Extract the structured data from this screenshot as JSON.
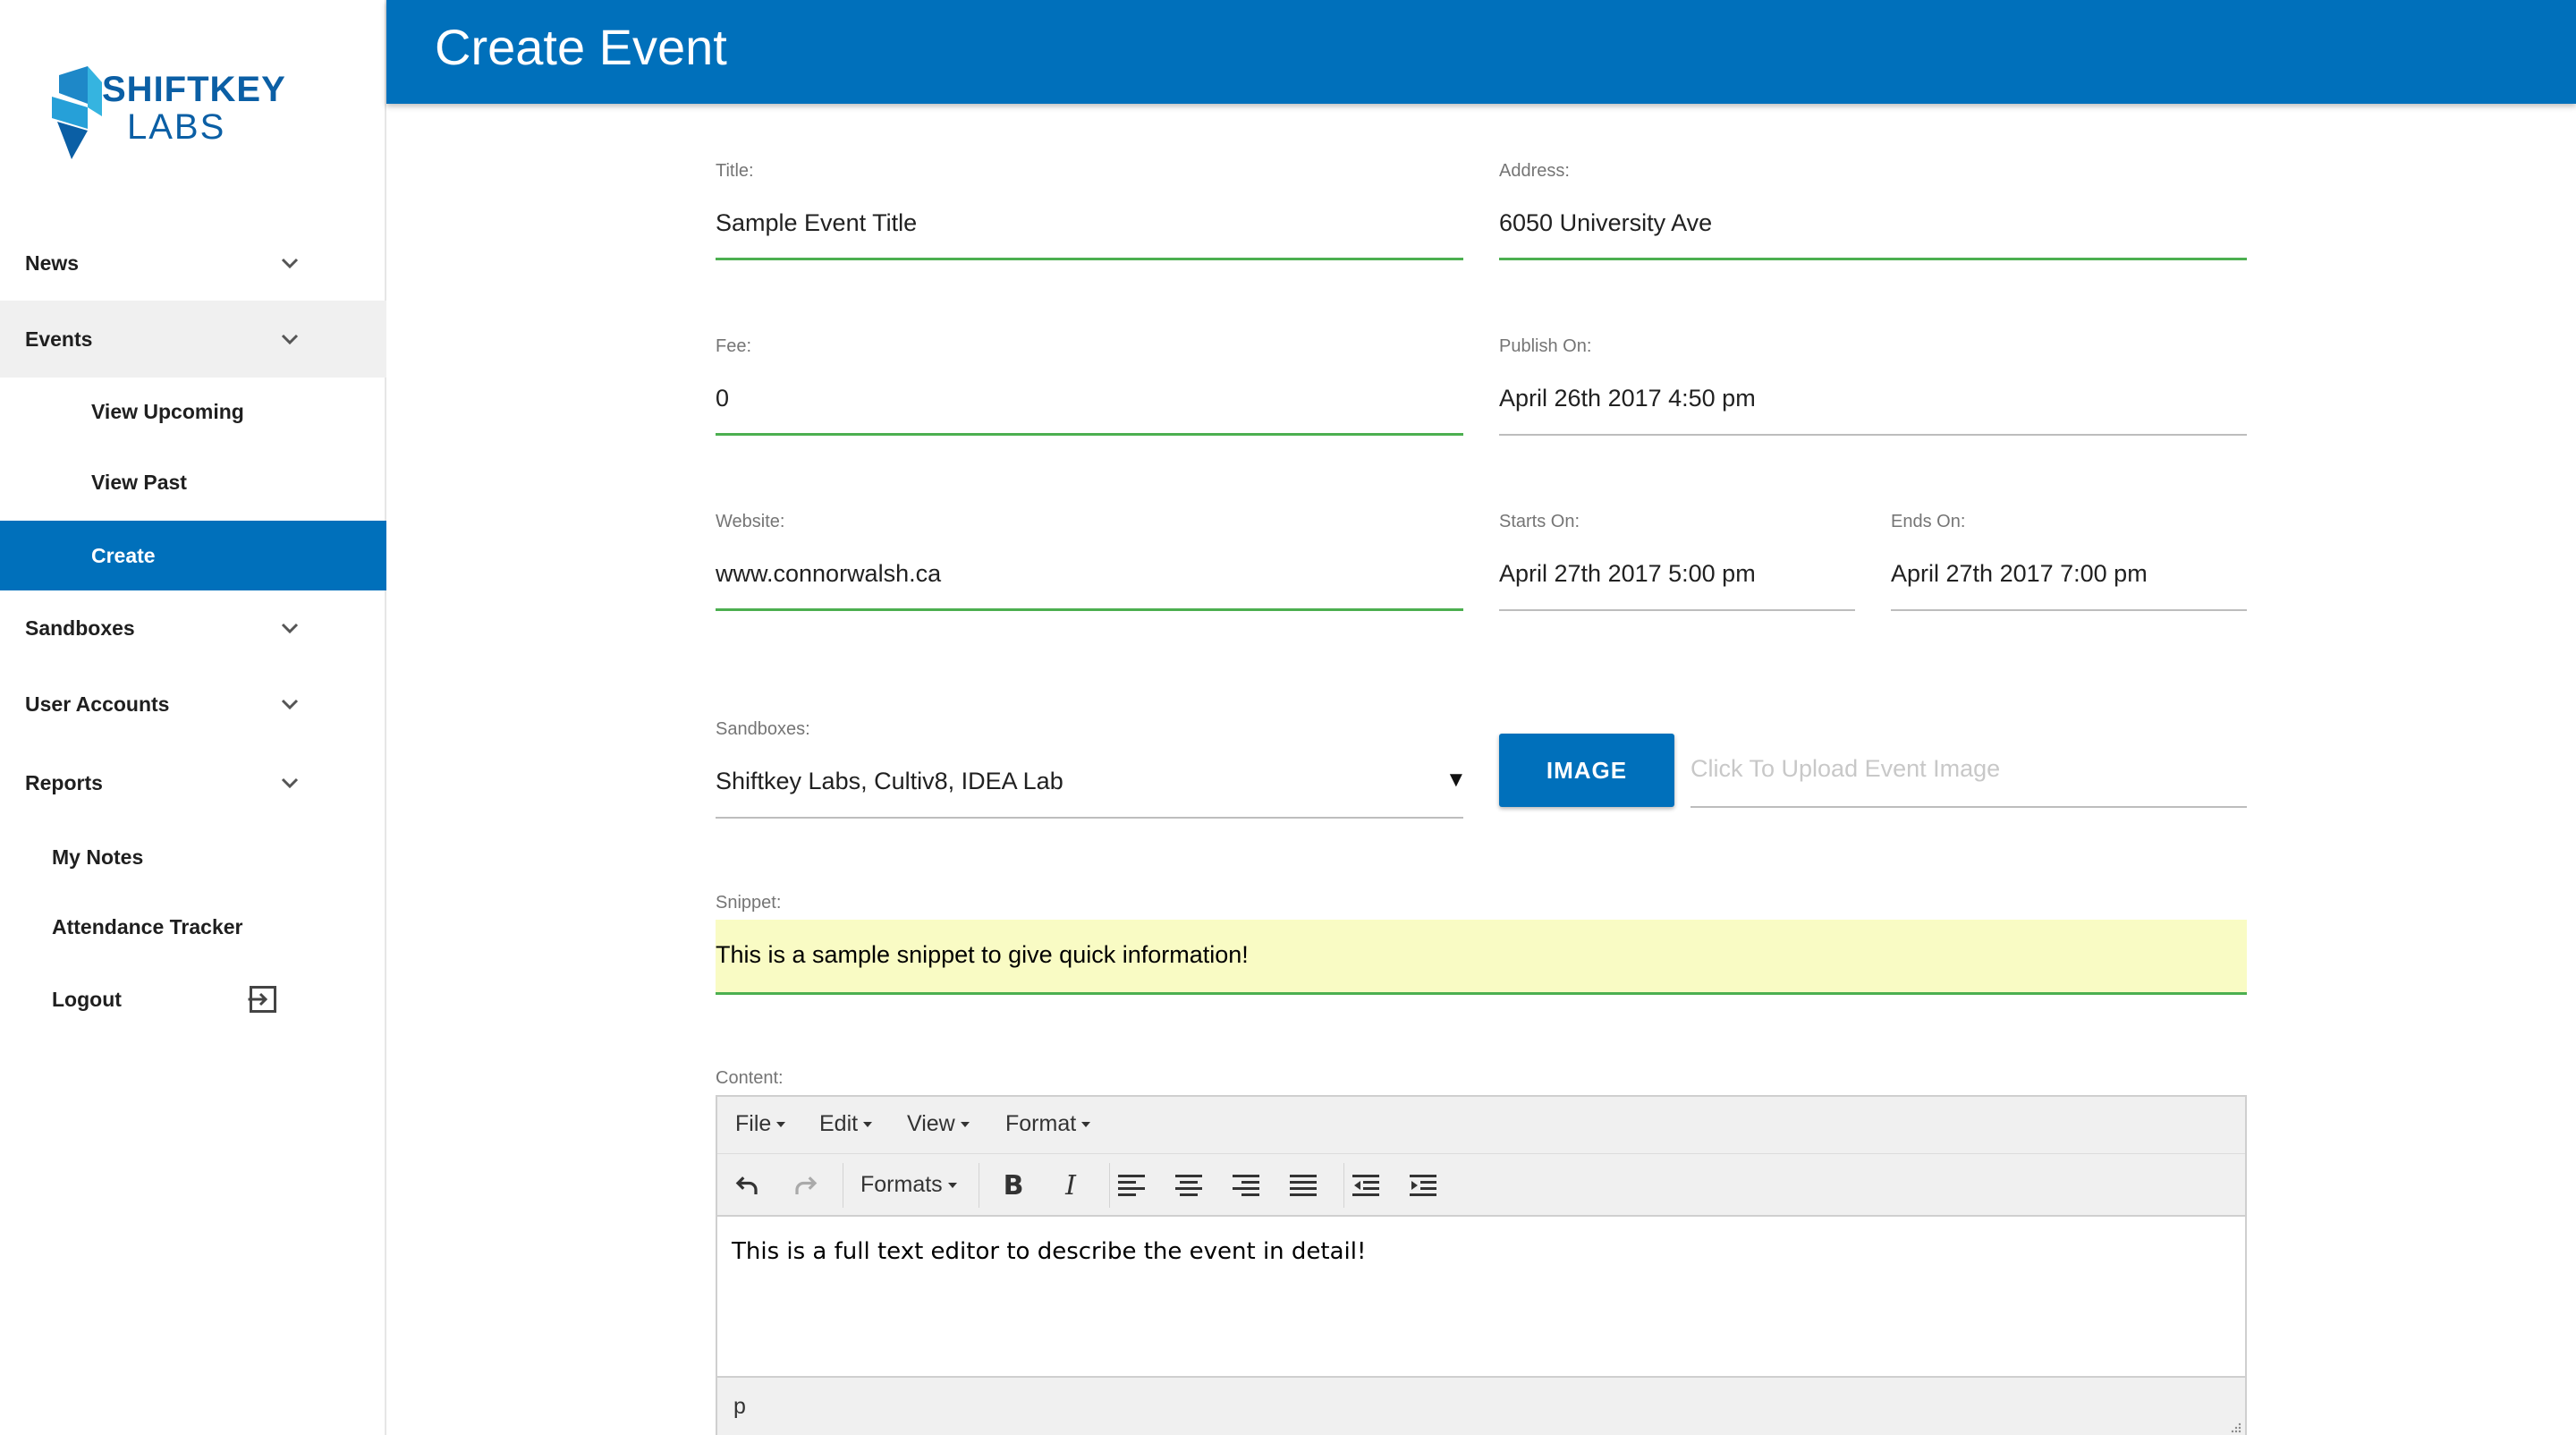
{
  "brand": {
    "line1": "SHIFTKEY",
    "line2": "LABS"
  },
  "header": {
    "title": "Create Event"
  },
  "sidebar": {
    "items": [
      {
        "label": "News"
      },
      {
        "label": "Events"
      },
      {
        "label": "View Upcoming"
      },
      {
        "label": "View Past"
      },
      {
        "label": "Create"
      },
      {
        "label": "Sandboxes"
      },
      {
        "label": "User Accounts"
      },
      {
        "label": "Reports"
      },
      {
        "label": "My Notes"
      },
      {
        "label": "Attendance Tracker"
      },
      {
        "label": "Logout"
      }
    ]
  },
  "form": {
    "title": {
      "label": "Title:",
      "value": "Sample Event Title"
    },
    "address": {
      "label": "Address:",
      "value": "6050 University Ave"
    },
    "fee": {
      "label": "Fee:",
      "value": "0"
    },
    "publish_on": {
      "label": "Publish On:",
      "value": "April 26th 2017 4:50 pm"
    },
    "website": {
      "label": "Website:",
      "value": "www.connorwalsh.ca"
    },
    "starts_on": {
      "label": "Starts On:",
      "value": "April 27th 2017 5:00 pm"
    },
    "ends_on": {
      "label": "Ends On:",
      "value": "April 27th 2017 7:00 pm"
    },
    "sandboxes": {
      "label": "Sandboxes:",
      "value": "Shiftkey Labs, Cultiv8, IDEA Lab",
      "arrow": "▼"
    },
    "image": {
      "button": "IMAGE",
      "placeholder": "Click To Upload Event Image"
    },
    "snippet": {
      "label": "Snippet:",
      "value": "This is a sample snippet to give quick information!"
    },
    "content": {
      "label": "Content:"
    }
  },
  "editor": {
    "menus": [
      "File",
      "Edit",
      "View",
      "Format"
    ],
    "formats_label": "Formats",
    "bold": "B",
    "italic": "I",
    "body": "This is a full text editor to describe the event in detail!",
    "path": "p"
  },
  "colors": {
    "primary": "#0070bb",
    "focus_green": "#4caf50",
    "snippet_bg": "#f9fbc4"
  }
}
